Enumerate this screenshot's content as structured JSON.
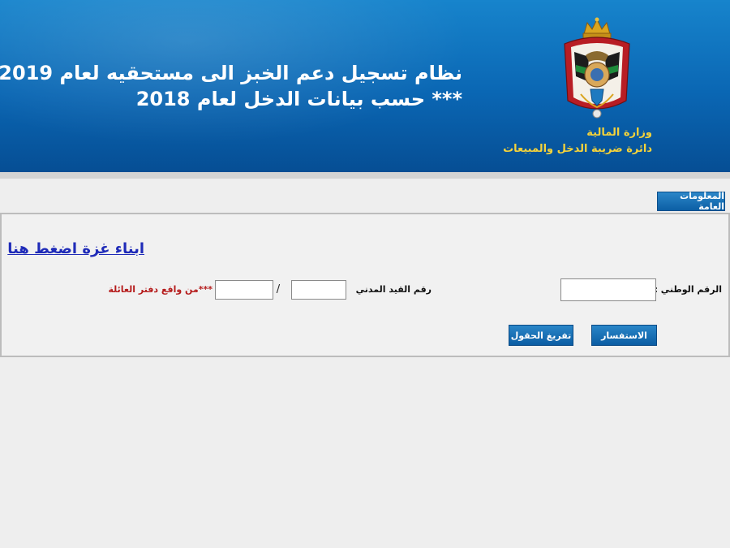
{
  "header": {
    "title_line1": "نظام تسجيل دعم الخبز الى مستحقيه لعام 2019",
    "title_line2": "***  حسب بيانات الدخل لعام 2018",
    "ministry_name": "وزارة المالية",
    "department_name": "دائرة ضريبة الدخل والمبيعات",
    "emblem_icon": "jordan-coat-of-arms-icon"
  },
  "section": {
    "tab_label": "المعلومات العامة"
  },
  "form": {
    "gaza_link": "ابناء غزة اضغط هنا",
    "national_id_label": "الرقم الوطني :",
    "national_id_value": "",
    "civil_record_label": "رقم القيد المدني",
    "civil_record_part1_value": "",
    "civil_record_part2_value": "",
    "separator": "/",
    "family_book_note": "***من واقع دفتر العائلة",
    "query_button": "الاستفسار",
    "clear_button": "تفريغ الحقول"
  },
  "colors": {
    "header_blue": "#0a66b3",
    "button_blue": "#0b5da3",
    "link_blue": "#1f2bb8",
    "note_red": "#b51b1b",
    "ministry_gold": "#f5d33a"
  }
}
